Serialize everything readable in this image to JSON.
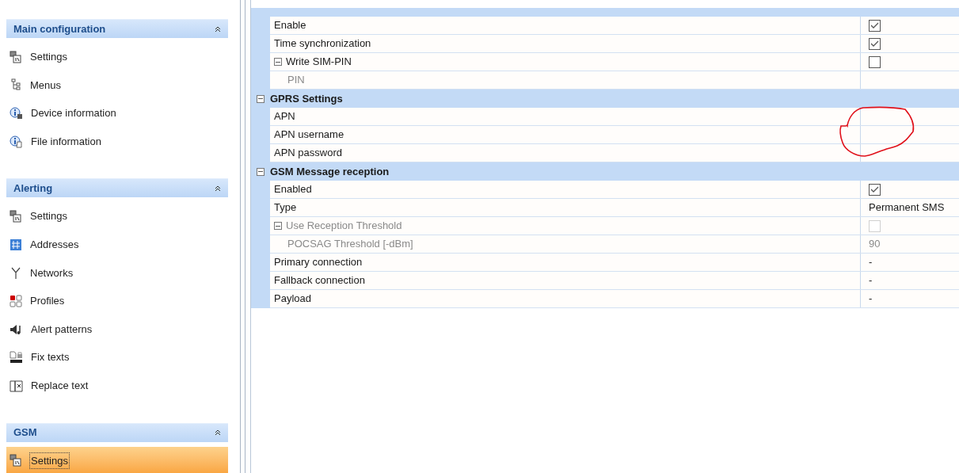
{
  "sidebar": {
    "sections": [
      {
        "title": "Main configuration",
        "expanded": true,
        "items": [
          {
            "label": "Settings",
            "selected": false
          },
          {
            "label": "Menus",
            "selected": false
          },
          {
            "label": "Device information",
            "selected": false
          },
          {
            "label": "File information",
            "selected": false
          }
        ]
      },
      {
        "title": "Alerting",
        "expanded": true,
        "items": [
          {
            "label": "Settings",
            "selected": false
          },
          {
            "label": "Addresses",
            "selected": false
          },
          {
            "label": "Networks",
            "selected": false
          },
          {
            "label": "Profiles",
            "selected": false
          },
          {
            "label": "Alert patterns",
            "selected": false
          },
          {
            "label": "Fix texts",
            "selected": false
          },
          {
            "label": "Replace text",
            "selected": false
          }
        ]
      },
      {
        "title": "GSM",
        "expanded": true,
        "items": [
          {
            "label": "Settings",
            "selected": true
          }
        ]
      }
    ]
  },
  "property_grid": {
    "rows": [
      {
        "kind": "checkbox",
        "label": "Enable",
        "checked": true,
        "disabled": false
      },
      {
        "kind": "checkbox",
        "label": "Time synchronization",
        "checked": true,
        "disabled": false
      },
      {
        "kind": "checkbox",
        "label": "Write SIM-PIN",
        "checked": false,
        "disabled": false,
        "expanded": true,
        "children": [
          {
            "kind": "empty",
            "label": "PIN",
            "disabled": true
          }
        ]
      },
      {
        "kind": "category",
        "label": "GPRS Settings",
        "expanded": true
      },
      {
        "kind": "empty",
        "label": "APN",
        "disabled": false
      },
      {
        "kind": "empty",
        "label": "APN username",
        "disabled": false
      },
      {
        "kind": "empty",
        "label": "APN password",
        "disabled": false
      },
      {
        "kind": "category",
        "label": "GSM Message reception",
        "expanded": true
      },
      {
        "kind": "checkbox",
        "label": "Enabled",
        "checked": true,
        "disabled": false
      },
      {
        "kind": "text",
        "label": "Type",
        "value": "Permanent SMS",
        "disabled": false
      },
      {
        "kind": "checkbox",
        "label": "Use Reception Threshold",
        "checked": false,
        "disabled": true,
        "expanded": true,
        "children": [
          {
            "kind": "text",
            "label": "POCSAG Threshold [-dBm]",
            "value": "90",
            "disabled": true
          }
        ]
      },
      {
        "kind": "text",
        "label": "Primary connection",
        "value": "-",
        "disabled": false
      },
      {
        "kind": "text",
        "label": "Fallback connection",
        "value": "-",
        "disabled": false
      },
      {
        "kind": "text",
        "label": "Payload",
        "value": "-",
        "disabled": false
      }
    ]
  }
}
